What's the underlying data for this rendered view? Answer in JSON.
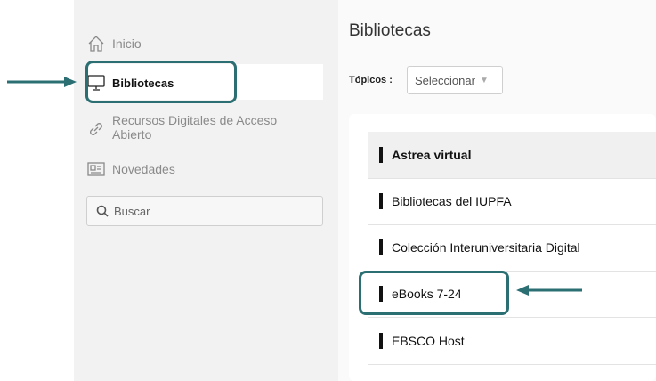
{
  "sidebar": {
    "items": [
      {
        "label": "Inicio",
        "icon": "home-icon"
      },
      {
        "label": "Bibliotecas",
        "icon": "monitor-icon"
      },
      {
        "label": "Recursos Digitales de Acceso Abierto",
        "icon": "link-icon"
      },
      {
        "label": "Novedades",
        "icon": "newspaper-icon"
      }
    ],
    "search_label": "Buscar"
  },
  "main": {
    "title": "Bibliotecas",
    "topics_label": "Tópicos :",
    "topics_select": "Seleccionar",
    "libraries": [
      "Astrea virtual",
      "Bibliotecas del IUPFA",
      "Colección Interuniversitaria Digital",
      "eBooks 7-24",
      "EBSCO Host"
    ]
  },
  "colors": {
    "annotation": "#2b6f73",
    "sidebar_bg": "#f2f2f2",
    "active_bg": "#ffffff"
  }
}
